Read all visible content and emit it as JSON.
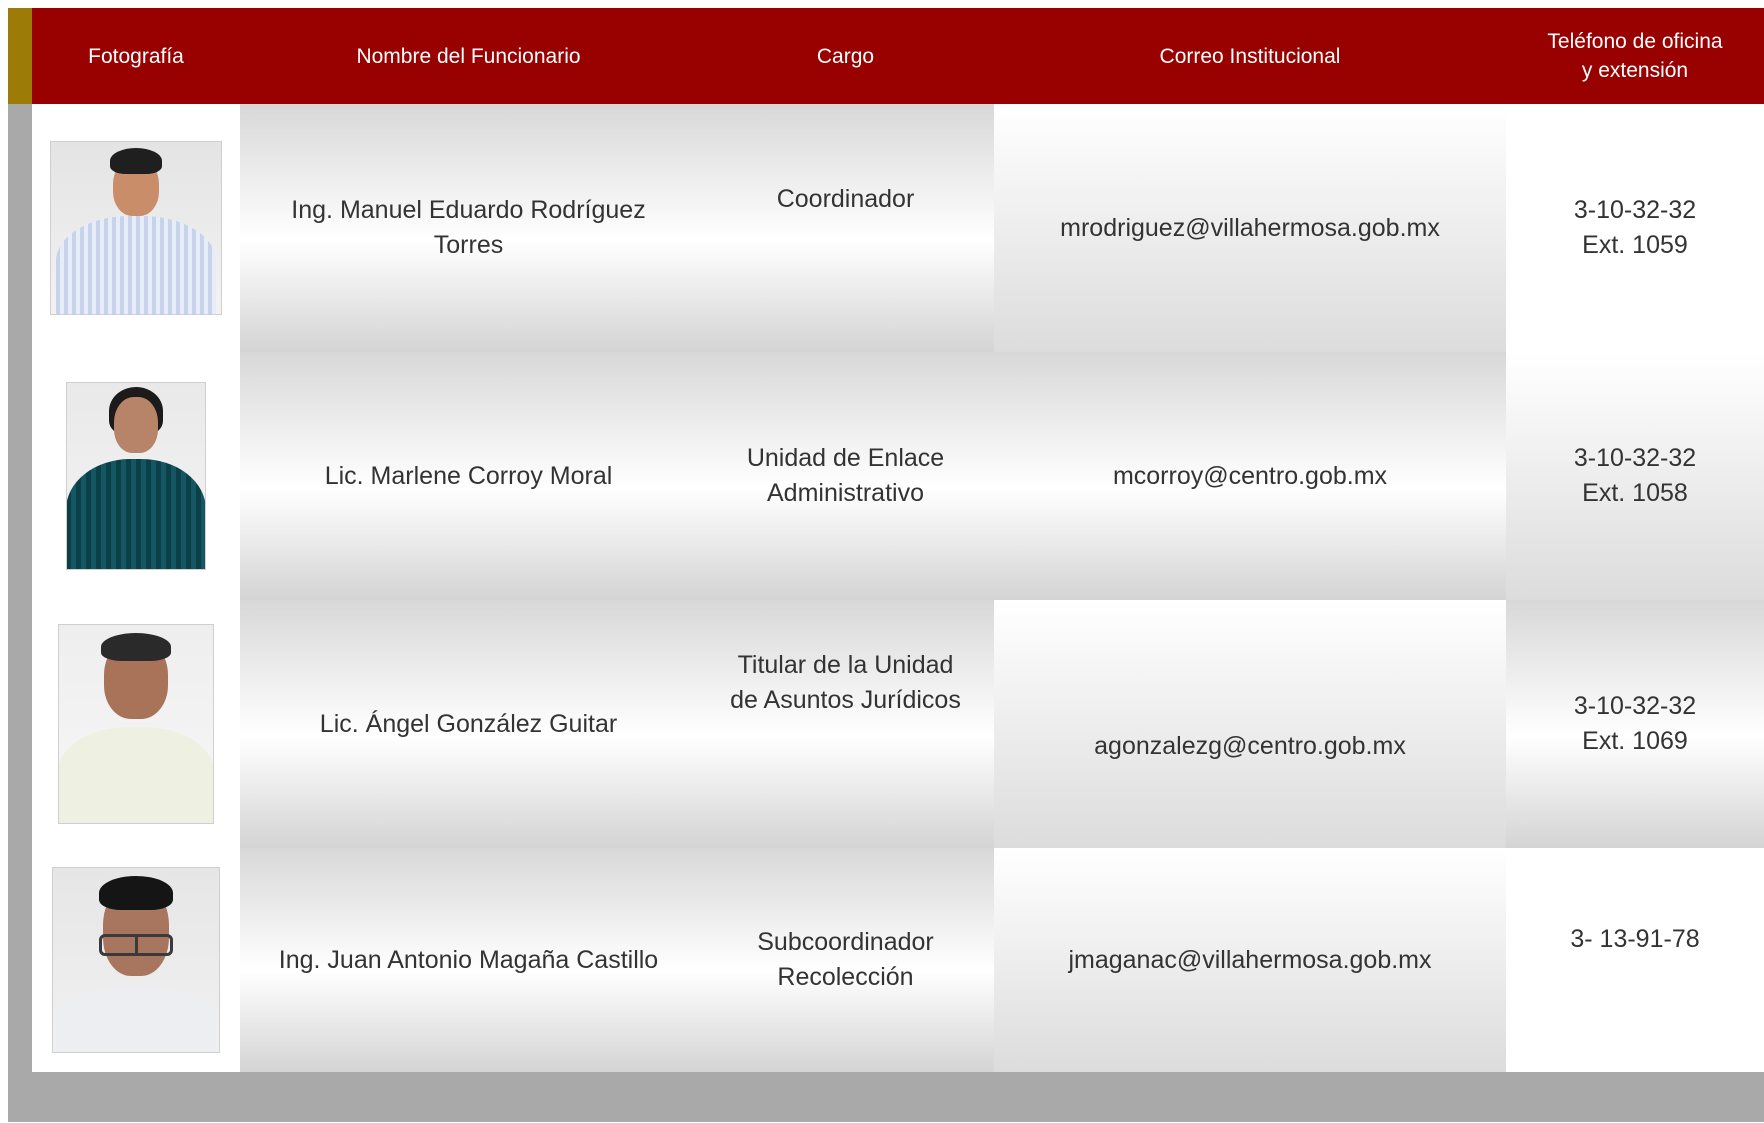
{
  "header": {
    "col_photo": "Fotografía",
    "col_name": "Nombre del Funcionario",
    "col_cargo": "Cargo",
    "col_mail": "Correo Institucional",
    "col_tel": "Teléfono de oficina\ny extensión"
  },
  "rows": [
    {
      "name": "Ing. Manuel Eduardo Rodríguez\nTorres",
      "cargo": "Coordinador",
      "email": "mrodriguez@villahermosa.gob.mx",
      "phone": "3-10-32-32\nExt. 1059"
    },
    {
      "name": "Lic. Marlene Corroy Moral",
      "cargo": "Unidad de Enlace\nAdministrativo",
      "email": "mcorroy@centro.gob.mx",
      "phone": "3-10-32-32\nExt. 1058"
    },
    {
      "name": "Lic. Ángel González Guitar",
      "cargo": "Titular de la Unidad\nde Asuntos Jurídicos",
      "email": "agonzalezg@centro.gob.mx",
      "phone": "3-10-32-32\nExt. 1069"
    },
    {
      "name": "Ing. Juan Antonio Magaña Castillo",
      "cargo": "Subcoordinador\nRecolección",
      "email": "jmaganac@villahermosa.gob.mx",
      "phone": "3- 13-91-78"
    }
  ],
  "colors": {
    "header_red": "#990000",
    "gold_accent": "#9c7b06",
    "frame_gray": "#a9a9a9"
  }
}
